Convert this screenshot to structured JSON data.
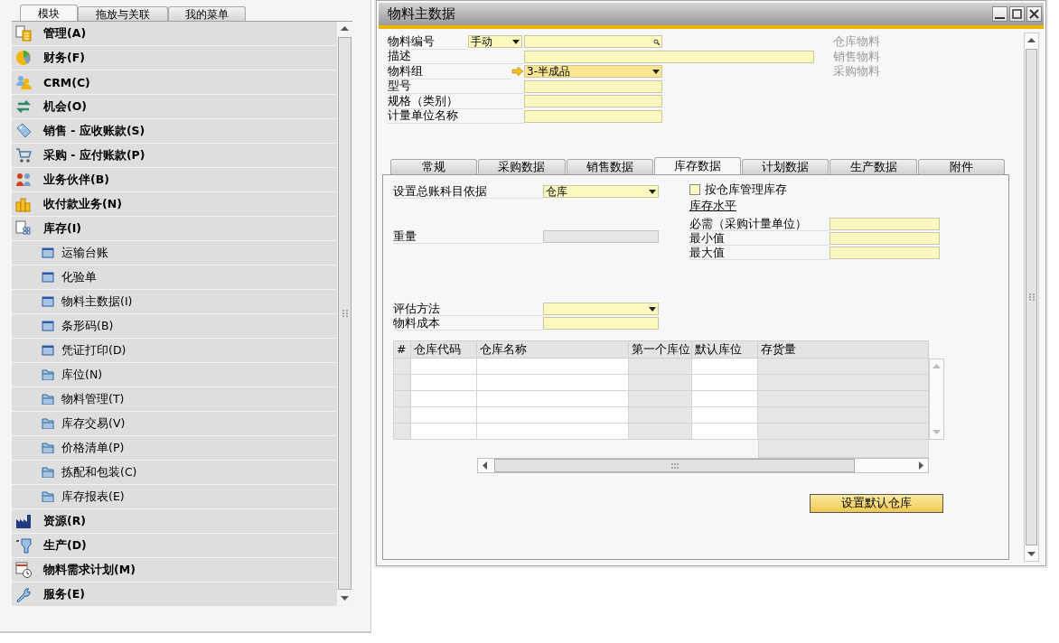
{
  "sidebar": {
    "tabs": [
      {
        "label": "模块",
        "selected": true
      },
      {
        "label": "拖放与关联",
        "selected": false
      },
      {
        "label": "我的菜单",
        "selected": false
      }
    ],
    "items": [
      {
        "label": "管理(A)"
      },
      {
        "label": "财务(F)"
      },
      {
        "label": "CRM(C)"
      },
      {
        "label": "机会(O)"
      },
      {
        "label": "销售 - 应收账款(S)"
      },
      {
        "label": "采购 - 应付账款(P)"
      },
      {
        "label": "业务伙伴(B)"
      },
      {
        "label": "收付款业务(N)"
      },
      {
        "label": "库存(I)",
        "children": [
          {
            "label": "运输台账",
            "kind": "form"
          },
          {
            "label": "化验单",
            "kind": "form"
          },
          {
            "label": "物料主数据(I)",
            "kind": "form"
          },
          {
            "label": "条形码(B)",
            "kind": "form"
          },
          {
            "label": "凭证打印(D)",
            "kind": "form"
          },
          {
            "label": "库位(N)",
            "kind": "folder"
          },
          {
            "label": "物料管理(T)",
            "kind": "folder"
          },
          {
            "label": "库存交易(V)",
            "kind": "folder"
          },
          {
            "label": "价格清单(P)",
            "kind": "folder"
          },
          {
            "label": "拣配和包装(C)",
            "kind": "folder"
          },
          {
            "label": "库存报表(E)",
            "kind": "folder"
          }
        ]
      },
      {
        "label": "资源(R)"
      },
      {
        "label": "生产(D)"
      },
      {
        "label": "物料需求计划(M)"
      },
      {
        "label": "服务(E)"
      }
    ]
  },
  "window": {
    "title": "物料主数据",
    "header_fields": [
      {
        "label": "物料编号",
        "kind": "numbered",
        "series": "手动"
      },
      {
        "label": "描述",
        "kind": "wide"
      },
      {
        "label": "物料组",
        "kind": "linked",
        "value": "3-半成品"
      },
      {
        "label": "型号",
        "kind": "text"
      },
      {
        "label": "规格（类别）",
        "kind": "text"
      },
      {
        "label": "计量单位名称",
        "kind": "text"
      }
    ],
    "item_types": [
      {
        "label": "仓库物料",
        "disabled": true
      },
      {
        "label": "销售物料",
        "disabled": true
      },
      {
        "label": "采购物料",
        "disabled": true
      }
    ],
    "tabs": [
      {
        "label": "常规",
        "selected": false
      },
      {
        "label": "采购数据",
        "selected": false
      },
      {
        "label": "销售数据",
        "selected": false
      },
      {
        "label": "库存数据",
        "selected": true
      },
      {
        "label": "计划数据",
        "selected": false
      },
      {
        "label": "生产数据",
        "selected": false
      },
      {
        "label": "附件",
        "selected": false
      }
    ],
    "inventory": {
      "left_fields": [
        {
          "label": "设置总账科目依据",
          "kind": "dropdown",
          "value": "仓库"
        },
        {
          "label": "重量",
          "kind": "disabled"
        },
        {
          "label": "评估方法",
          "kind": "dropdown"
        },
        {
          "label": "物料成本",
          "kind": "text"
        }
      ],
      "manage_by_warehouse": {
        "label": "按仓库管理库存",
        "checked": false
      },
      "stock_level": {
        "heading": "库存水平",
        "fields": [
          {
            "label": "必需（采购计量单位）"
          },
          {
            "label": "最小值"
          },
          {
            "label": "最大值"
          }
        ]
      },
      "table": {
        "columns": [
          {
            "label": "#",
            "editable": false
          },
          {
            "label": "仓库代码",
            "editable": true
          },
          {
            "label": "仓库名称",
            "editable": true
          },
          {
            "label": "第一个库位",
            "editable": false
          },
          {
            "label": "默认库位",
            "editable": true
          },
          {
            "label": "存货量",
            "editable": false
          }
        ]
      },
      "button": "设置默认仓库"
    }
  }
}
